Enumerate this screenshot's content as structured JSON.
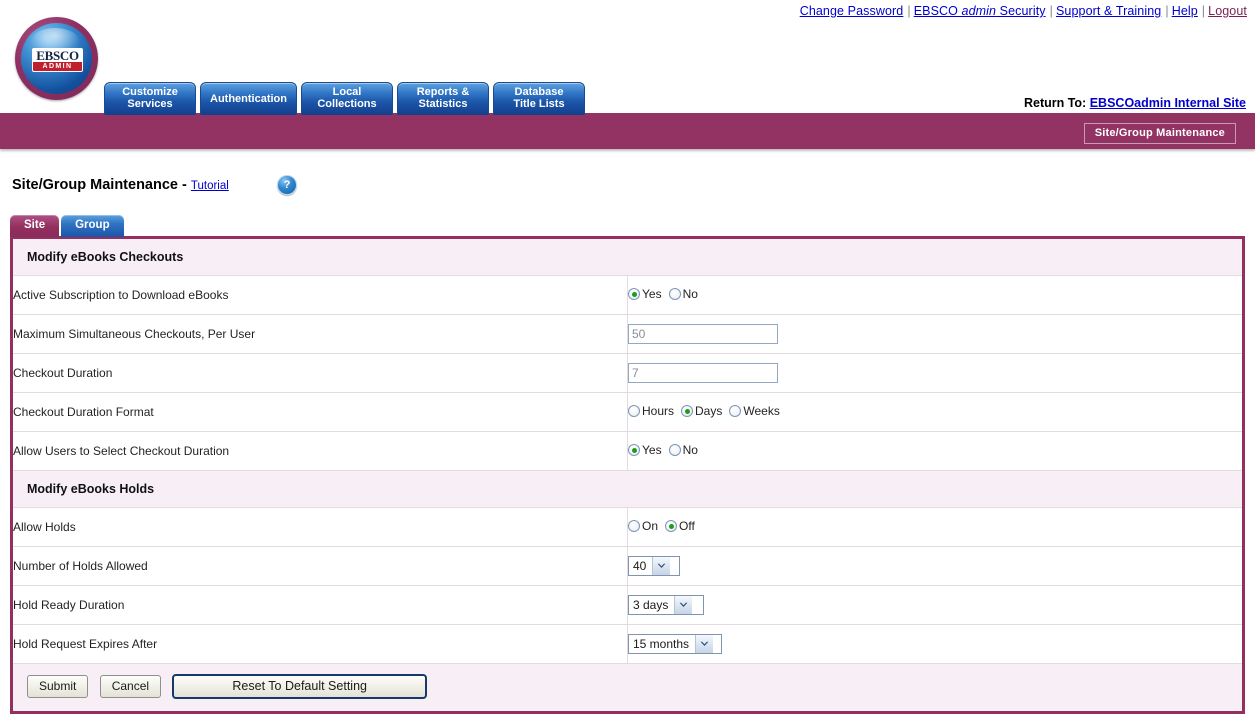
{
  "utility_links": [
    {
      "label": "Change Password",
      "style": "link"
    },
    {
      "label": "EBSCO ",
      "italic": "admin",
      "label_tail": " Security",
      "style": "link-italic"
    },
    {
      "label": "Support & Training",
      "style": "link"
    },
    {
      "label": "Help",
      "style": "link"
    },
    {
      "label": "Logout",
      "style": "logout"
    }
  ],
  "logo": {
    "brand": "EBSCO",
    "sub": "ADMIN"
  },
  "nav_tabs": [
    {
      "line1": "Customize",
      "line2": "Services"
    },
    {
      "line1": "Authentication",
      "line2": ""
    },
    {
      "line1": "Local",
      "line2": "Collections"
    },
    {
      "line1": "Reports &",
      "line2": "Statistics"
    },
    {
      "line1": "Database",
      "line2": "Title Lists"
    }
  ],
  "banner": {
    "return_prefix": "Return To:",
    "return_link": "EBSCOadmin Internal Site",
    "button_label": "Site/Group Maintenance"
  },
  "page": {
    "title": "Site/Group Maintenance",
    "dash": "-",
    "tutorial_link": "Tutorial",
    "help_icon": "?"
  },
  "subtabs": [
    {
      "label": "Site",
      "active": true
    },
    {
      "label": "Group",
      "active": false
    }
  ],
  "sections": [
    {
      "title": "Modify eBooks Checkouts"
    },
    {
      "title": "Modify eBooks Holds"
    }
  ],
  "rows": {
    "active_subscription": {
      "label": "Active Subscription to Download eBooks",
      "options": [
        "Yes",
        "No"
      ],
      "selected": "Yes"
    },
    "max_checkouts": {
      "label": "Maximum Simultaneous Checkouts, Per User",
      "value": "50"
    },
    "checkout_duration": {
      "label": "Checkout Duration",
      "value": "7"
    },
    "duration_format": {
      "label": "Checkout Duration Format",
      "options": [
        "Hours",
        "Days",
        "Weeks"
      ],
      "selected": "Days"
    },
    "allow_select_duration": {
      "label": "Allow Users to Select Checkout Duration",
      "options": [
        "Yes",
        "No"
      ],
      "selected": "Yes"
    },
    "allow_holds": {
      "label": "Allow Holds",
      "options": [
        "On",
        "Off"
      ],
      "selected": "Off"
    },
    "number_of_holds": {
      "label": "Number of Holds Allowed",
      "value": "40"
    },
    "hold_ready_duration": {
      "label": "Hold Ready Duration",
      "value": "3 days"
    },
    "hold_expires_after": {
      "label": "Hold Request Expires After",
      "value": "15 months"
    }
  },
  "buttons": {
    "submit": "Submit",
    "cancel": "Cancel",
    "reset": "Reset To Default Setting"
  },
  "colors": {
    "brand_purple": "#93305f",
    "banner_purple": "#933363",
    "tab_blue": "#1c55a8",
    "link_blue": "#0000cc",
    "panel_bg": "#f7eff5",
    "radio_dot_green": "#1d9b1d"
  }
}
